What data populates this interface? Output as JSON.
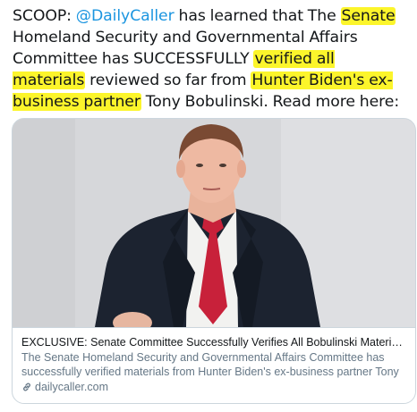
{
  "tweet": {
    "part1": "SCOOP: ",
    "mention": "@DailyCaller",
    "part2": " has learned that The ",
    "hl1": "Senate",
    "part3": " Homeland Security and Governmental Affairs Committee has SUCCESSFULLY ",
    "hl2": "verified all materials",
    "part4": " reviewed so far from ",
    "hl3": "Hunter Biden's ex-business partner",
    "part5": " Tony Bobulinski. Read more here:"
  },
  "card": {
    "title": "EXCLUSIVE: Senate Committee Successfully Verifies All Bobulinski Materials Revie...",
    "description": "The Senate Homeland Security and Governmental Affairs Committee has successfully verified materials from Hunter Biden's ex-business partner Tony ...",
    "domain": "dailycaller.com",
    "link_icon": "link-icon",
    "image_subject": "photo-of-man-in-suit"
  },
  "colors": {
    "mention": "#1b95e0",
    "highlight": "#fcf52b",
    "tie": "#c8213a",
    "suit": "#1c2330"
  }
}
